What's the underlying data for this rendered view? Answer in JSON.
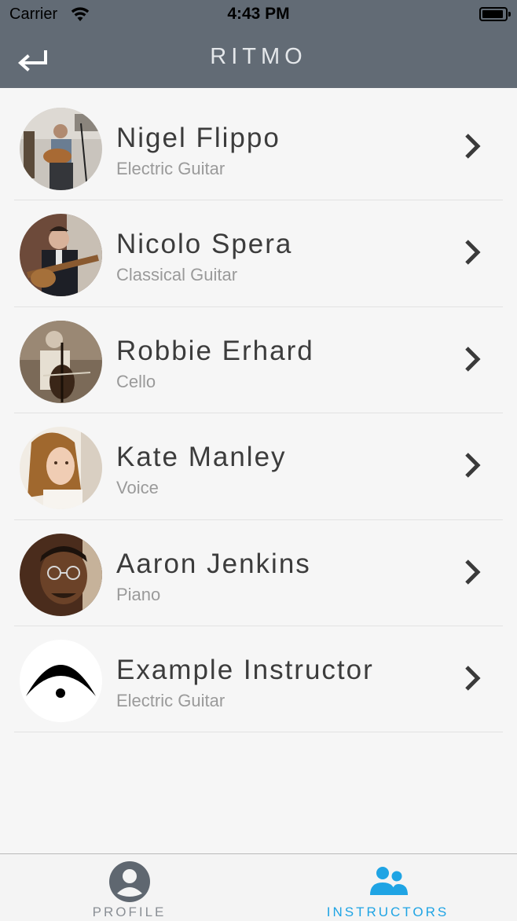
{
  "status_bar": {
    "carrier": "Carrier",
    "time": "4:43 PM"
  },
  "nav": {
    "title": "RITMO",
    "back_icon": "return-arrow-icon"
  },
  "instructors": [
    {
      "name": "Nigel Flippo",
      "instrument": "Electric Guitar"
    },
    {
      "name": "Nicolo Spera",
      "instrument": "Classical Guitar"
    },
    {
      "name": "Robbie Erhard",
      "instrument": "Cello"
    },
    {
      "name": "Kate Manley",
      "instrument": "Voice"
    },
    {
      "name": "Aaron Jenkins",
      "instrument": "Piano"
    },
    {
      "name": "Example Instructor",
      "instrument": "Electric Guitar"
    }
  ],
  "tab_bar": {
    "profile_label": "PROFILE",
    "instructors_label": "INSTRUCTORS",
    "active_tab": "INSTRUCTORS"
  },
  "colors": {
    "nav_background": "#626b75",
    "active_tab": "#1fa4e4",
    "inactive_tab": "#5f6770",
    "page_background": "#f6f6f6"
  }
}
